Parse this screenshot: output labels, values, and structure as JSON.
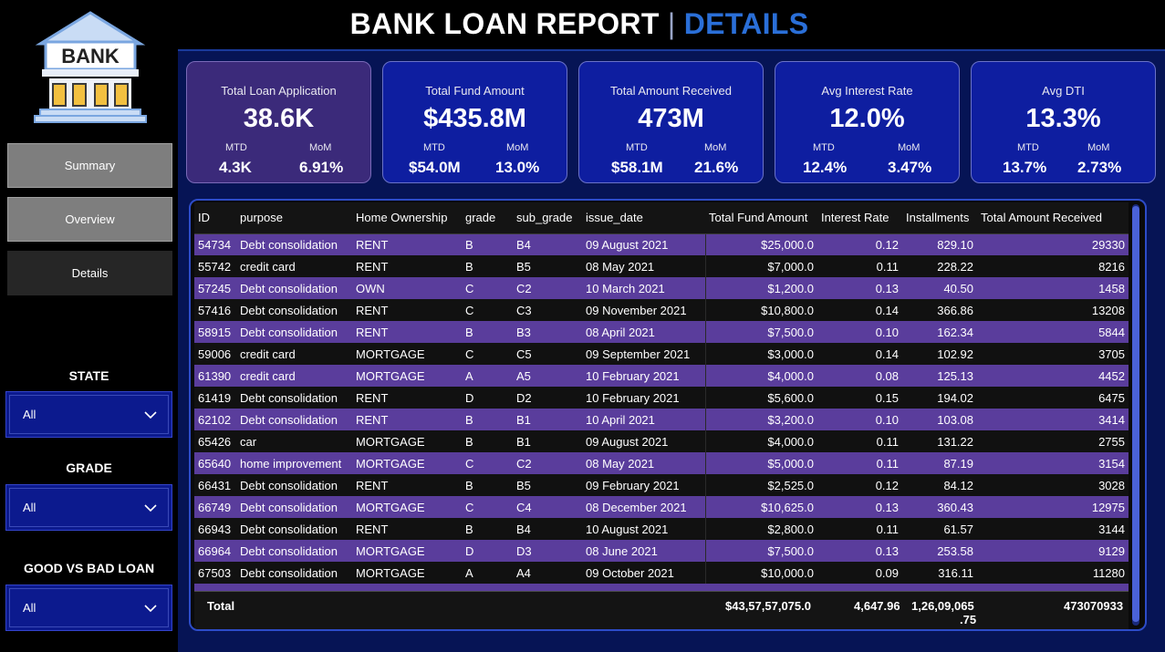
{
  "header": {
    "title_main": "BANK LOAN REPORT",
    "title_sep": "|",
    "title_accent": "DETAILS"
  },
  "logo": {
    "text": "BANK",
    "icon": "bank-building-icon"
  },
  "nav": {
    "summary": "Summary",
    "overview": "Overview",
    "details": "Details"
  },
  "filters": {
    "state": {
      "title": "STATE",
      "value": "All"
    },
    "grade": {
      "title": "GRADE",
      "value": "All"
    },
    "loan": {
      "title": "GOOD VS BAD LOAN",
      "value": "All"
    }
  },
  "kpis": [
    {
      "label": "Total Loan Application",
      "value": "38.6K",
      "mtd_label": "MTD",
      "mtd": "4.3K",
      "mom_label": "MoM",
      "mom": "6.91%"
    },
    {
      "label": "Total Fund Amount",
      "value": "$435.8M",
      "mtd_label": "MTD",
      "mtd": "$54.0M",
      "mom_label": "MoM",
      "mom": "13.0%"
    },
    {
      "label": "Total Amount Received",
      "value": "473M",
      "mtd_label": "MTD",
      "mtd": "$58.1M",
      "mom_label": "MoM",
      "mom": "21.6%"
    },
    {
      "label": "Avg Interest Rate",
      "value": "12.0%",
      "mtd_label": "MTD",
      "mtd": "12.4%",
      "mom_label": "MoM",
      "mom": "3.47%"
    },
    {
      "label": "Avg DTI",
      "value": "13.3%",
      "mtd_label": "MTD",
      "mtd": "13.7%",
      "mom_label": "MoM",
      "mom": "2.73%"
    }
  ],
  "table": {
    "columns": [
      "ID",
      "purpose",
      "Home Ownership",
      "grade",
      "sub_grade",
      "issue_date",
      "Total Fund Amount",
      "Interest Rate",
      "Installments",
      "Total Amount Received"
    ],
    "rows": [
      [
        "54734",
        "Debt consolidation",
        "RENT",
        "B",
        "B4",
        "09 August 2021",
        "$25,000.0",
        "0.12",
        "829.10",
        "29330"
      ],
      [
        "55742",
        "credit card",
        "RENT",
        "B",
        "B5",
        "08 May 2021",
        "$7,000.0",
        "0.11",
        "228.22",
        "8216"
      ],
      [
        "57245",
        "Debt consolidation",
        "OWN",
        "C",
        "C2",
        "10 March 2021",
        "$1,200.0",
        "0.13",
        "40.50",
        "1458"
      ],
      [
        "57416",
        "Debt consolidation",
        "RENT",
        "C",
        "C3",
        "09 November 2021",
        "$10,800.0",
        "0.14",
        "366.86",
        "13208"
      ],
      [
        "58915",
        "Debt consolidation",
        "RENT",
        "B",
        "B3",
        "08 April 2021",
        "$7,500.0",
        "0.10",
        "162.34",
        "5844"
      ],
      [
        "59006",
        "credit card",
        "MORTGAGE",
        "C",
        "C5",
        "09 September 2021",
        "$3,000.0",
        "0.14",
        "102.92",
        "3705"
      ],
      [
        "61390",
        "credit card",
        "MORTGAGE",
        "A",
        "A5",
        "10 February 2021",
        "$4,000.0",
        "0.08",
        "125.13",
        "4452"
      ],
      [
        "61419",
        "Debt consolidation",
        "RENT",
        "D",
        "D2",
        "10 February 2021",
        "$5,600.0",
        "0.15",
        "194.02",
        "6475"
      ],
      [
        "62102",
        "Debt consolidation",
        "RENT",
        "B",
        "B1",
        "10 April 2021",
        "$3,200.0",
        "0.10",
        "103.08",
        "3414"
      ],
      [
        "65426",
        "car",
        "MORTGAGE",
        "B",
        "B1",
        "09 August 2021",
        "$4,000.0",
        "0.11",
        "131.22",
        "2755"
      ],
      [
        "65640",
        "home improvement",
        "MORTGAGE",
        "C",
        "C2",
        "08 May 2021",
        "$5,000.0",
        "0.11",
        "87.19",
        "3154"
      ],
      [
        "66431",
        "Debt consolidation",
        "RENT",
        "B",
        "B5",
        "09 February 2021",
        "$2,525.0",
        "0.12",
        "84.12",
        "3028"
      ],
      [
        "66749",
        "Debt consolidation",
        "MORTGAGE",
        "C",
        "C4",
        "08 December 2021",
        "$10,625.0",
        "0.13",
        "360.43",
        "12975"
      ],
      [
        "66943",
        "Debt consolidation",
        "RENT",
        "B",
        "B4",
        "10 August 2021",
        "$2,800.0",
        "0.11",
        "61.57",
        "3144"
      ],
      [
        "66964",
        "Debt consolidation",
        "MORTGAGE",
        "D",
        "D3",
        "08 June 2021",
        "$7,500.0",
        "0.13",
        "253.58",
        "9129"
      ],
      [
        "67503",
        "Debt consolidation",
        "MORTGAGE",
        "A",
        "A4",
        "09 October 2021",
        "$10,000.0",
        "0.09",
        "316.11",
        "11280"
      ]
    ],
    "total": {
      "label": "Total",
      "fund": "$43,57,57,075.0",
      "interest": "4,647.96",
      "installments_line1": "1,26,09,065",
      "installments_line2": ".75",
      "received": "473070933"
    }
  },
  "colors": {
    "row_odd": "#5a3d9c",
    "row_even": "#111111",
    "kpi_bg": "#0e1ea0",
    "kpi_first_bg": "#3b2a7a",
    "accent": "#2a6fd8"
  }
}
